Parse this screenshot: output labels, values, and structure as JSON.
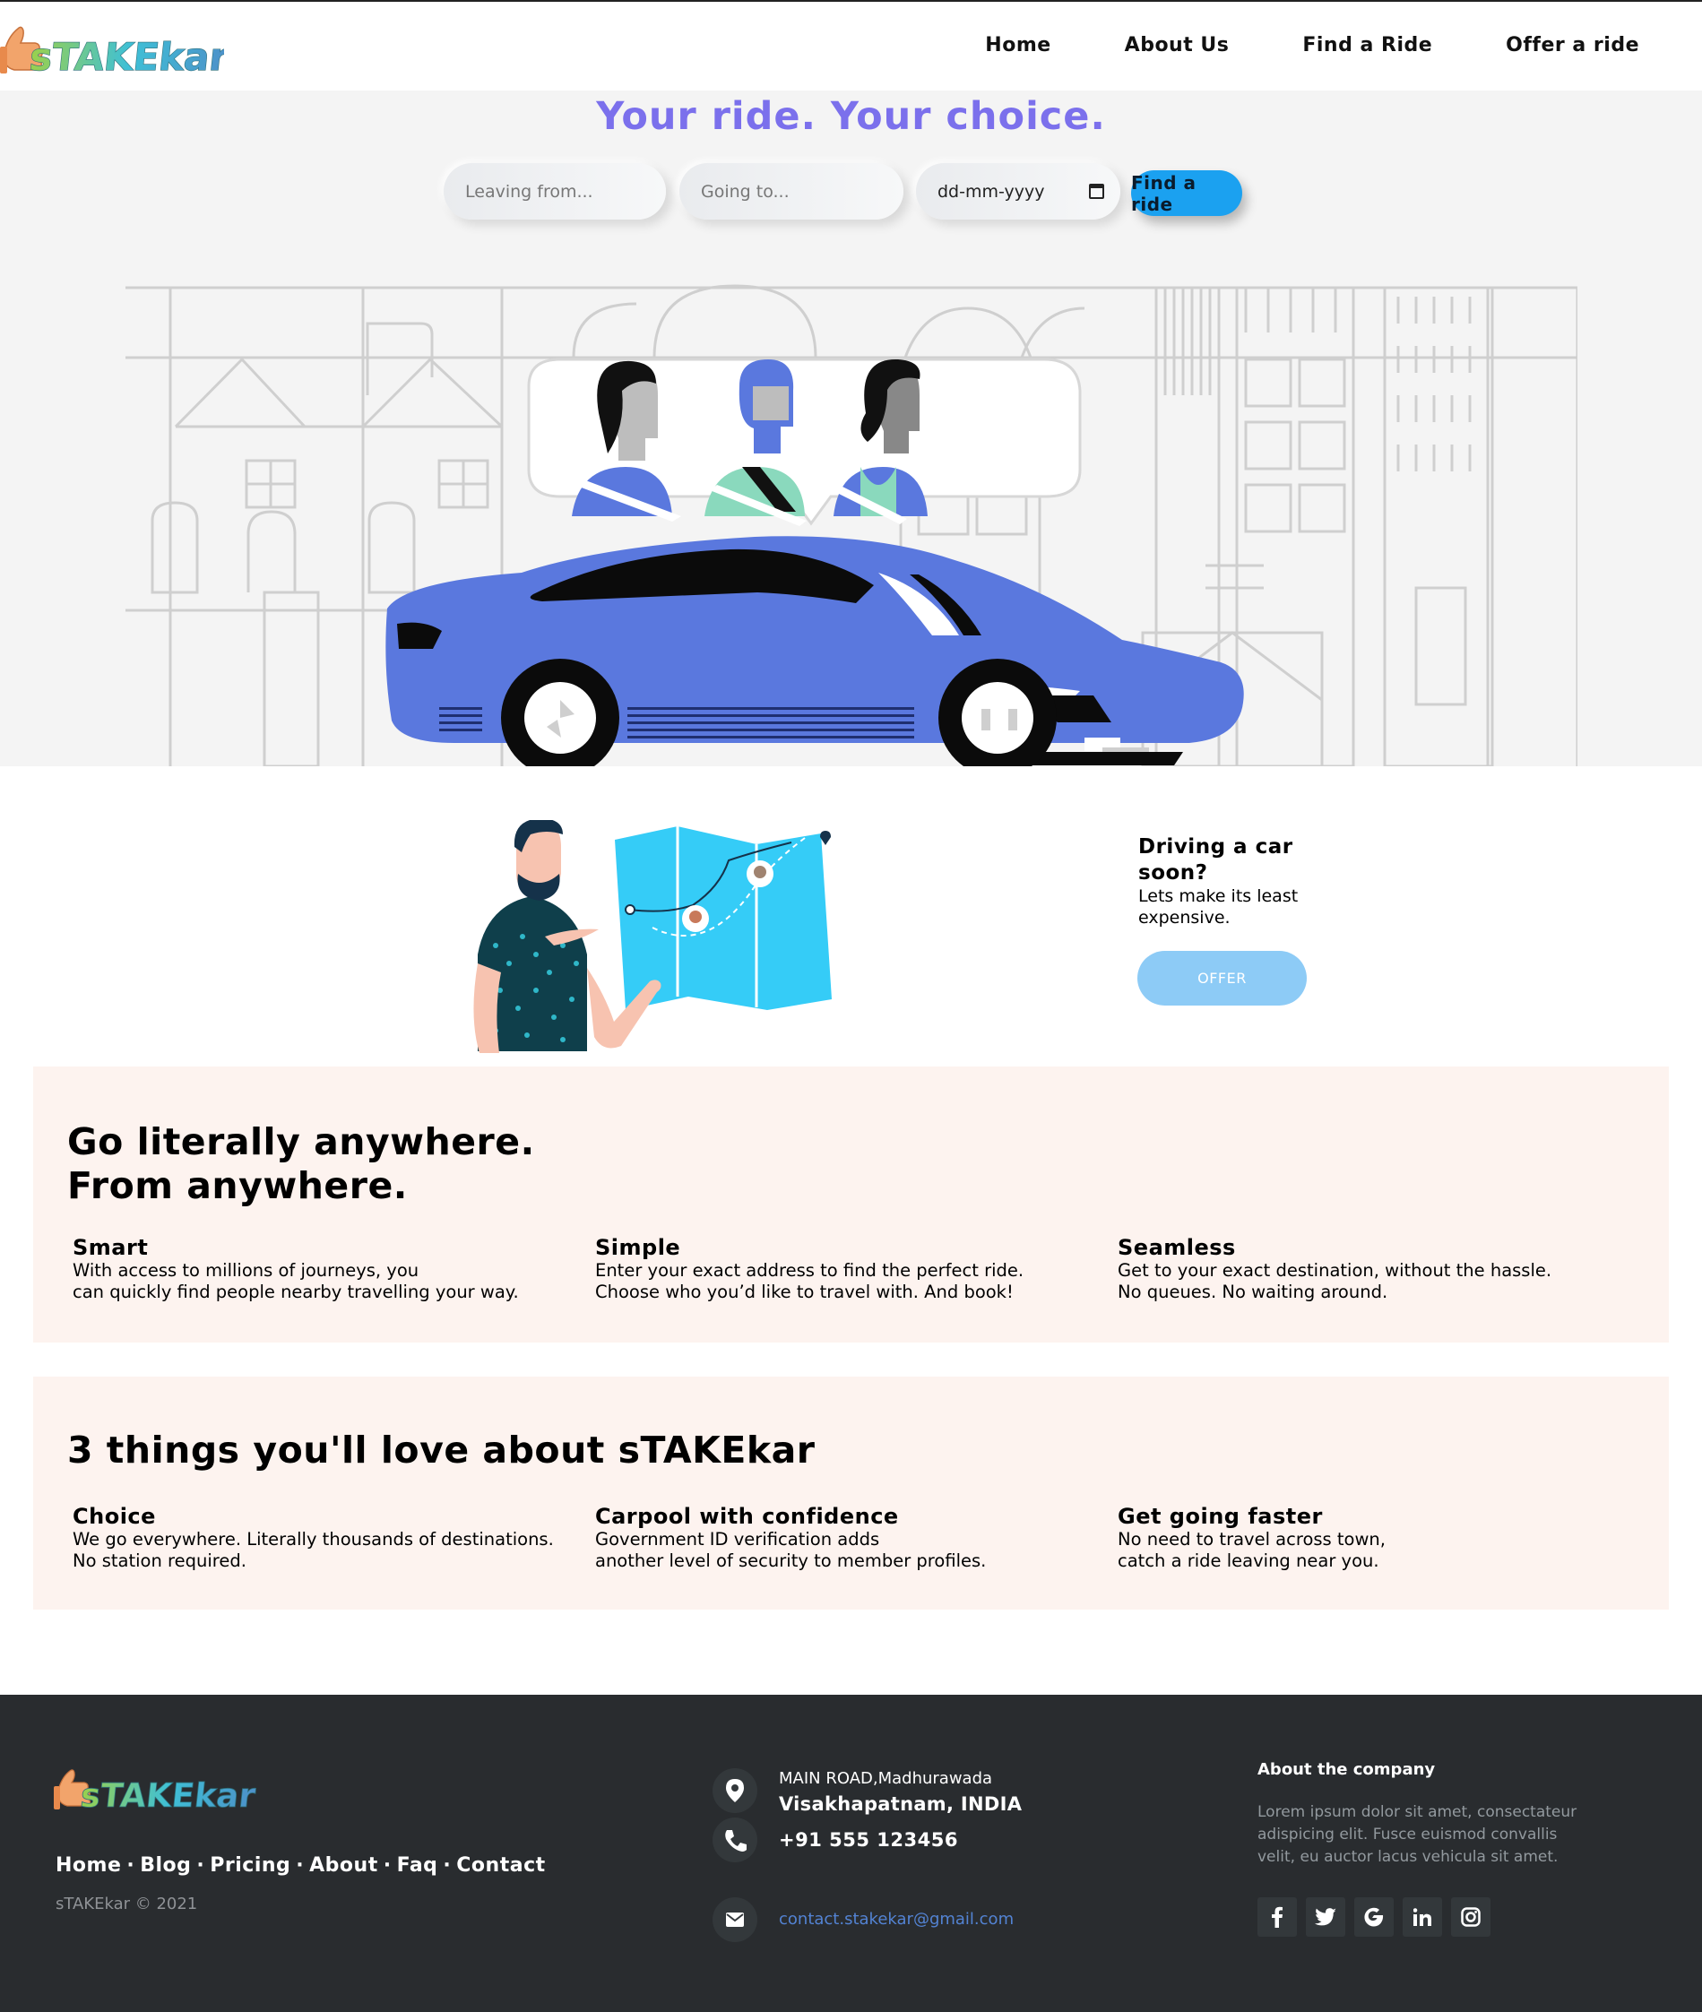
{
  "nav": {
    "brand": "sTAKEkar",
    "items": [
      {
        "label": "Home"
      },
      {
        "label": "About Us"
      },
      {
        "label": "Find a Ride"
      },
      {
        "label": "Offer a ride"
      }
    ]
  },
  "hero": {
    "title": "Your ride. Your choice.",
    "from_placeholder": "Leaving from...",
    "to_placeholder": "Going to...",
    "date_placeholder": "dd-mm-yyyy",
    "find_button": "Find a ride"
  },
  "offer": {
    "title": "Driving a car soon?",
    "subtitle": "Lets make its least expensive.",
    "button": "OFFER"
  },
  "anywhere": {
    "heading_line1": "Go literally anywhere.",
    "heading_line2": "From anywhere.",
    "features": [
      {
        "title": "Smart",
        "line1": "With access to millions of journeys, you",
        "line2": "can quickly find people nearby travelling your way."
      },
      {
        "title": "Simple",
        "line1": "Enter your exact address to find the perfect ride.",
        "line2": "Choose who you’d like to travel with. And book!"
      },
      {
        "title": "Seamless",
        "line1": "Get to your exact destination, without the hassle.",
        "line2": "No queues. No waiting around."
      }
    ]
  },
  "love": {
    "heading": "3 things you'll love about sTAKEkar",
    "features": [
      {
        "title": "Choice",
        "line1": "We go everywhere. Literally thousands of destinations.",
        "line2": "No station required."
      },
      {
        "title": "Carpool with confidence",
        "line1": "Government ID verification adds",
        "line2": "another level of security to member profiles."
      },
      {
        "title": "Get going faster",
        "line1": "No need to travel across town,",
        "line2": "catch a ride leaving near you."
      }
    ]
  },
  "footer": {
    "links": [
      "Home",
      "Blog",
      "Pricing",
      "About",
      "Faq",
      "Contact"
    ],
    "separator": "·",
    "copyright": "sTAKEkar © 2021",
    "address_line1": "MAIN ROAD,Madhurawada",
    "address_line2": "Visakhapatnam, INDIA",
    "phone": "+91 555 123456",
    "email": "contact.stakekar@gmail.com",
    "about_title": "About the company",
    "about_text": "Lorem ipsum dolor sit amet, consectateur adispicing elit. Fusce euismod convallis velit, eu auctor lacus vehicula sit amet.",
    "social_icons": [
      "facebook-icon",
      "twitter-icon",
      "google-icon",
      "linkedin-icon",
      "instagram-icon"
    ]
  },
  "colors": {
    "accent_title": "#7b70ec",
    "button_blue": "#1ba1f0",
    "offer_button": "#8dcbf6",
    "panel_bg": "#fdf3ef",
    "footer_bg": "#292c2f",
    "car_blue": "#5a78de"
  }
}
